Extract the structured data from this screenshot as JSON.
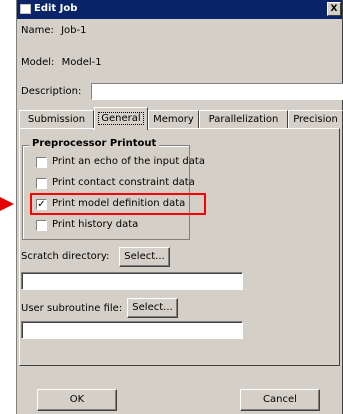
{
  "window": {
    "title": "Edit Job",
    "close_glyph": "X"
  },
  "job": {
    "name_label": "Name:",
    "name_value": "Job-1",
    "model_label": "Model:",
    "model_value": "Model-1",
    "description_label": "Description:",
    "description_value": ""
  },
  "tabs": [
    {
      "label": "Submission",
      "active": false
    },
    {
      "label": "General",
      "active": true
    },
    {
      "label": "Memory",
      "active": false
    },
    {
      "label": "Parallelization",
      "active": false
    },
    {
      "label": "Precision",
      "active": false
    }
  ],
  "preprocessor": {
    "title": "Preprocessor Printout",
    "options": [
      {
        "label": "Print an echo of the input data",
        "checked": false
      },
      {
        "label": "Print contact constraint data",
        "checked": false
      },
      {
        "label": "Print model definition data",
        "checked": true
      },
      {
        "label": "Print history data",
        "checked": false
      }
    ]
  },
  "scratch": {
    "label": "Scratch directory:",
    "button": "Select...",
    "value": ""
  },
  "subroutine": {
    "label": "User subroutine file:",
    "button": "Select...",
    "value": ""
  },
  "footer": {
    "ok": "OK",
    "cancel": "Cancel"
  },
  "colors": {
    "titlebar": "#0a246a",
    "highlight": "#ff0000",
    "arrow": "#e60000",
    "face": "#d4d0c8"
  }
}
